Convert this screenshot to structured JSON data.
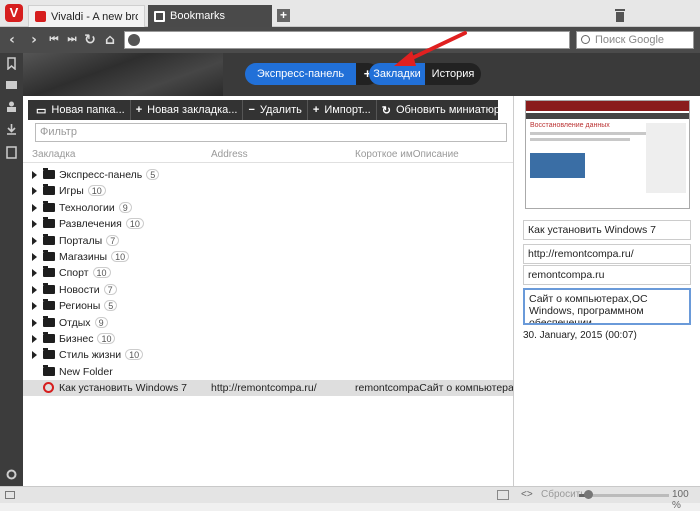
{
  "tabs": [
    {
      "title": "Vivaldi - A new browser fo"
    },
    {
      "title": "Bookmarks"
    }
  ],
  "logo_letter": "V",
  "new_tab_glyph": "+",
  "search": {
    "placeholder": "Поиск Google"
  },
  "strip": {
    "express_label": "Экспресс-панель",
    "plus_label": "+",
    "bookmarks_label": "Закладки",
    "history_label": "История"
  },
  "toolbar": {
    "new_folder": "Новая папка...",
    "new_bookmark": "Новая закладка...",
    "delete": "Удалить",
    "import": "Импорт...",
    "refresh": "Обновить миниатюру..."
  },
  "filter": {
    "placeholder": "Фильтр"
  },
  "columns": {
    "name": "Закладка",
    "address": "Address",
    "nick_desc": "Короткое имОписание"
  },
  "rows": [
    {
      "name": "Экспресс-панель",
      "count": "5"
    },
    {
      "name": "Игры",
      "count": "10"
    },
    {
      "name": "Технологии",
      "count": "9"
    },
    {
      "name": "Развлечения",
      "count": "10"
    },
    {
      "name": "Порталы",
      "count": "7"
    },
    {
      "name": "Магазины",
      "count": "10"
    },
    {
      "name": "Спорт",
      "count": "10"
    },
    {
      "name": "Новости",
      "count": "7"
    },
    {
      "name": "Регионы",
      "count": "5"
    },
    {
      "name": "Отдых",
      "count": "9"
    },
    {
      "name": "Бизнес",
      "count": "10"
    },
    {
      "name": "Стиль жизни",
      "count": "10"
    },
    {
      "name": "New Folder"
    },
    {
      "name": "Как установить Windows 7",
      "address": "http://remontcompa.ru/",
      "nick": "remontcompaСайт о компьютерах,ОС W"
    }
  ],
  "details": {
    "title": "Как установить Windows 7",
    "url": "http://remontcompa.ru/",
    "nick": "remontcompa.ru",
    "description": "Сайт о компьютерах,ОС Windows, программном обеспечении",
    "date": "30. January, 2015 (00:07)",
    "thumb_heading": "Восстановление данных"
  },
  "status": {
    "code_label": "<>",
    "reset_label": "Сбросить",
    "zoom": "100 %",
    "zoom_fraction": 0.1
  },
  "colors": {
    "accent_blue": "#2170d8",
    "vivaldi_red": "#d61e1e"
  }
}
